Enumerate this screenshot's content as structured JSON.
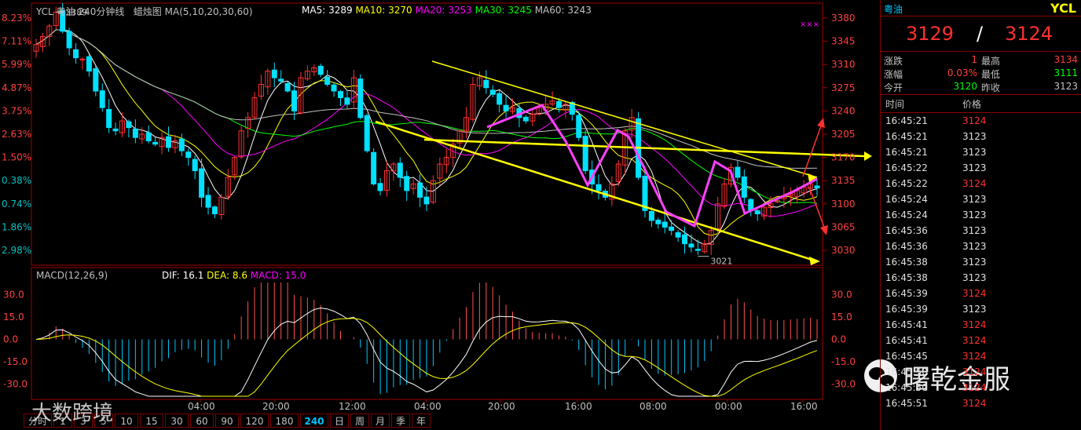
{
  "header": {
    "symbol": "YCL",
    "name": "粤油",
    "period": "240分钟线",
    "chart_kind": "蜡烛图",
    "ma_params": "MA(5,10,20,30,60)",
    "ma": [
      {
        "label": "MA5:",
        "value": "3289",
        "color": "#ffffff"
      },
      {
        "label": "MA10:",
        "value": "3270",
        "color": "#ffff00"
      },
      {
        "label": "MA20:",
        "value": "3253",
        "color": "#ff00ff"
      },
      {
        "label": "MA30:",
        "value": "3245",
        "color": "#00ff00"
      },
      {
        "label": "MA60:",
        "value": "3243",
        "color": "#c0c0c0"
      }
    ],
    "marker": "×××"
  },
  "price_axis": {
    "right": [
      "3380",
      "3345",
      "3310",
      "3275",
      "3240",
      "3205",
      "3170",
      "3135",
      "3100",
      "3065",
      "3030"
    ],
    "left": [
      "8.23%",
      "7.11%",
      "5.99%",
      "4.87%",
      "3.75%",
      "2.63%",
      "1.50%",
      "0.38%",
      "0.74%",
      "1.86%",
      "2.98%"
    ]
  },
  "annotations": {
    "high_label": "3389",
    "low_label": "3021"
  },
  "macd": {
    "title": "MACD(12,26,9)",
    "dif_label": "DIF:",
    "dif_value": "16.1",
    "dea_label": "DEA:",
    "dea_value": "8.6",
    "macd_label": "MACD:",
    "macd_value": "15.0",
    "axis": [
      "30.0",
      "15.0",
      "0.0",
      "-15.0",
      "-30.0"
    ]
  },
  "time_axis": [
    "04:00",
    "20:00",
    "12:00",
    "04:00",
    "20:00",
    "16:00",
    "08:00",
    "00:00",
    "16:00"
  ],
  "periods": [
    {
      "label": "分时",
      "active": false
    },
    {
      "label": "1",
      "active": false
    },
    {
      "label": "3",
      "active": false
    },
    {
      "label": "5",
      "active": false
    },
    {
      "label": "10",
      "active": false
    },
    {
      "label": "15",
      "active": false
    },
    {
      "label": "30",
      "active": false
    },
    {
      "label": "60",
      "active": false
    },
    {
      "label": "90",
      "active": false
    },
    {
      "label": "120",
      "active": false
    },
    {
      "label": "180",
      "active": false
    },
    {
      "label": "240",
      "active": true
    },
    {
      "label": "日",
      "active": false
    },
    {
      "label": "周",
      "active": false
    },
    {
      "label": "月",
      "active": false
    },
    {
      "label": "季",
      "active": false
    },
    {
      "label": "年",
      "active": false
    }
  ],
  "panel": {
    "name": "粤油",
    "code": "YCL",
    "bid": "3129",
    "separator": "/",
    "ask": "3124",
    "quotes": [
      {
        "l1": "涨跌",
        "v1": "1",
        "c1": "#ff4040",
        "l2": "最高",
        "v2": "3134",
        "c2": "#ff4040"
      },
      {
        "l1": "涨幅",
        "v1": "0.03%",
        "c1": "#ff4040",
        "l2": "最低",
        "v2": "3111",
        "c2": "#00ff00"
      },
      {
        "l1": "今开",
        "v1": "3120",
        "c1": "#00ff00",
        "l2": "昨收",
        "v2": "3123",
        "c2": "#c0c0c0"
      }
    ],
    "trades_header": {
      "time": "时间",
      "price": "价格"
    },
    "trades": [
      {
        "time": "16:45:21",
        "price": "3124",
        "color": "#ff3030"
      },
      {
        "time": "16:45:21",
        "price": "3123",
        "color": "#e0e0e0"
      },
      {
        "time": "16:45:21",
        "price": "3123",
        "color": "#e0e0e0"
      },
      {
        "time": "16:45:22",
        "price": "3123",
        "color": "#e0e0e0"
      },
      {
        "time": "16:45:22",
        "price": "3124",
        "color": "#ff3030"
      },
      {
        "time": "16:45:24",
        "price": "3123",
        "color": "#e0e0e0"
      },
      {
        "time": "16:45:24",
        "price": "3123",
        "color": "#e0e0e0"
      },
      {
        "time": "16:45:36",
        "price": "3123",
        "color": "#e0e0e0"
      },
      {
        "time": "16:45:36",
        "price": "3123",
        "color": "#e0e0e0"
      },
      {
        "time": "16:45:38",
        "price": "3123",
        "color": "#e0e0e0"
      },
      {
        "time": "16:45:38",
        "price": "3123",
        "color": "#e0e0e0"
      },
      {
        "time": "16:45:39",
        "price": "3124",
        "color": "#ff3030"
      },
      {
        "time": "16:45:39",
        "price": "3123",
        "color": "#e0e0e0"
      },
      {
        "time": "16:45:41",
        "price": "3124",
        "color": "#ff3030"
      },
      {
        "time": "16:45:41",
        "price": "3124",
        "color": "#ff3030"
      },
      {
        "time": "16:45:45",
        "price": "3124",
        "color": "#ff3030"
      },
      {
        "time": "16:45:50",
        "price": "3124",
        "color": "#ff3030"
      },
      {
        "time": "16:45:50",
        "price": "3124",
        "color": "#ff3030"
      },
      {
        "time": "16:45:51",
        "price": "3124",
        "color": "#ff3030"
      }
    ]
  },
  "watermarks": {
    "left": "大数跨境",
    "right": "曙乾金服"
  },
  "chart_data": {
    "type": "candlestick",
    "price_range": [
      3021,
      3389
    ],
    "macd_range": [
      -30,
      30
    ],
    "closes": [
      3340,
      3352,
      3368,
      3389,
      3360,
      3335,
      3320,
      3318,
      3300,
      3270,
      3245,
      3215,
      3210,
      3225,
      3215,
      3200,
      3205,
      3195,
      3190,
      3200,
      3185,
      3195,
      3180,
      3170,
      3150,
      3110,
      3095,
      3085,
      3110,
      3140,
      3170,
      3210,
      3230,
      3260,
      3280,
      3300,
      3290,
      3285,
      3270,
      3240,
      3290,
      3300,
      3305,
      3295,
      3280,
      3270,
      3260,
      3250,
      3290,
      3230,
      3180,
      3130,
      3120,
      3150,
      3160,
      3140,
      3120,
      3130,
      3110,
      3100,
      3135,
      3160,
      3170,
      3190,
      3210,
      3230,
      3280,
      3290,
      3275,
      3265,
      3250,
      3240,
      3245,
      3230,
      3225,
      3235,
      3245,
      3250,
      3255,
      3245,
      3250,
      3235,
      3200,
      3150,
      3130,
      3120,
      3110,
      3130,
      3160,
      3210,
      3230,
      3140,
      3090,
      3075,
      3070,
      3065,
      3060,
      3050,
      3040,
      3035,
      3030,
      3040,
      3060,
      3100,
      3130,
      3155,
      3140,
      3110,
      3090,
      3085,
      3095,
      3100,
      3105,
      3110,
      3115,
      3120,
      3125,
      3130,
      3124
    ]
  }
}
